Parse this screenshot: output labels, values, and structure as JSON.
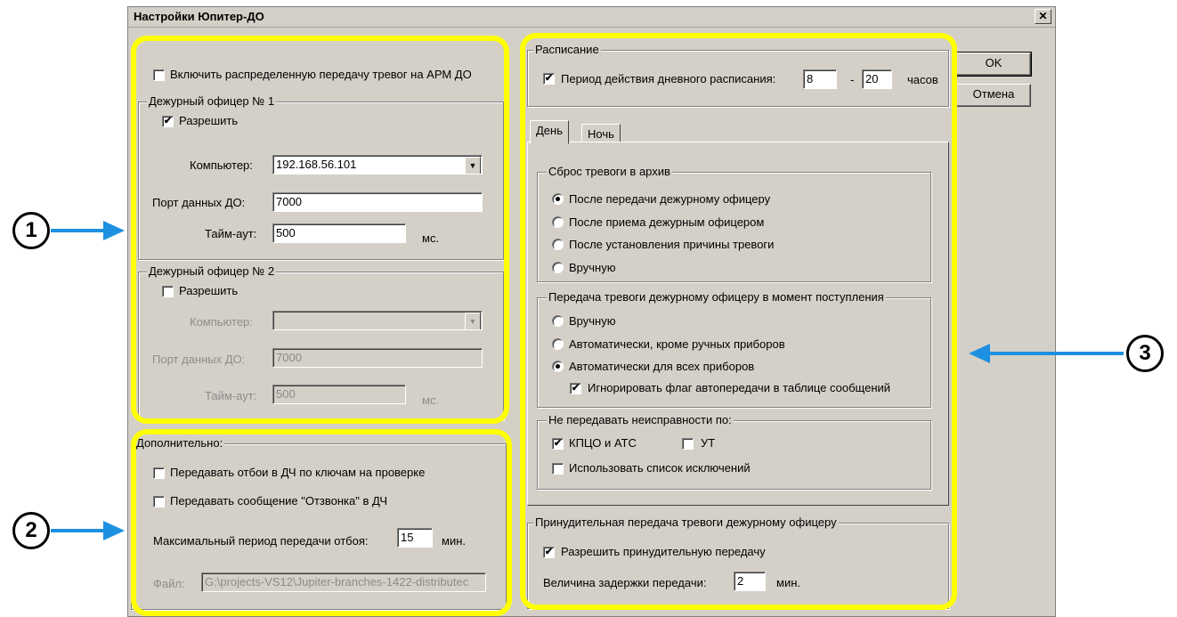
{
  "dialog": {
    "title": "Настройки Юпитер-ДО",
    "close_glyph": "✕",
    "ok_label": "OK",
    "cancel_label": "Отмена"
  },
  "left": {
    "enable_distributed": {
      "label": "Включить распределенную передачу тревог на АРМ ДО",
      "checked": false
    },
    "officer1": {
      "title": "Дежурный офицер № 1",
      "allow_label": "Разрешить",
      "allow_checked": true,
      "computer_label": "Компьютер:",
      "computer_value": "192.168.56.101",
      "port_label": "Порт данных ДО:",
      "port_value": "7000",
      "timeout_label": "Тайм-аут:",
      "timeout_value": "500",
      "timeout_unit": "мс."
    },
    "officer2": {
      "title": "Дежурный офицер № 2",
      "allow_label": "Разрешить",
      "allow_checked": false,
      "computer_label": "Компьютер:",
      "computer_value": "",
      "port_label": "Порт данных ДО:",
      "port_value": "7000",
      "timeout_label": "Тайм-аут:",
      "timeout_value": "500",
      "timeout_unit": "мс."
    },
    "extra": {
      "title": "Дополнительно:",
      "send_cancel_label": "Передавать отбои в ДЧ по ключам на проверке",
      "send_callback_label": "Передавать сообщение \"Отзвонка\" в ДЧ",
      "max_period_label": "Максимальный период передачи отбоя:",
      "max_period_value": "15",
      "max_period_unit": "мин.",
      "file_label": "Файл:",
      "file_value": "G:\\projects-VS12\\Jupiter-branches-1422-distributec"
    }
  },
  "right": {
    "schedule": {
      "title": "Расписание",
      "day_period_label": "Период действия дневного расписания:",
      "day_period_checked": true,
      "from_value": "8",
      "dash": "-",
      "to_value": "20",
      "unit": "часов"
    },
    "tabs": [
      "День",
      "Ночь"
    ],
    "active_tab": 0,
    "archive": {
      "title": "Сброс тревоги в архив",
      "options": [
        "После передачи дежурному офицеру",
        "После приема дежурным офицером",
        "После установления причины тревоги",
        "Вручную"
      ],
      "selected": 0
    },
    "transfer": {
      "title": "Передача тревоги дежурному офицеру в момент поступления",
      "options": [
        "Вручную",
        "Автоматически, кроме ручных приборов",
        "Автоматически для всех приборов"
      ],
      "selected": 2,
      "ignore_flag_label": "Игнорировать флаг автопередачи в таблице сообщений",
      "ignore_flag_checked": true
    },
    "faults": {
      "title": "Не передавать неисправности по:",
      "kpco_label": "КПЦО и АТС",
      "kpco_checked": true,
      "ut_label": "УТ",
      "ut_checked": false,
      "exclusions_label": "Использовать список исключений",
      "exclusions_checked": false
    },
    "forced": {
      "title": "Принудительная передача тревоги дежурному офицеру",
      "allow_label": "Разрешить принудительную передачу",
      "allow_checked": true,
      "delay_label": "Величина задержки передачи:",
      "delay_value": "2",
      "delay_unit": "мин."
    }
  },
  "annotations": {
    "markers": [
      "1",
      "2",
      "3"
    ],
    "highlight_color": "#ffff00",
    "arrow_color": "#1e90e0"
  },
  "glyphs": {
    "check": "✔",
    "dropdown": "▼"
  }
}
